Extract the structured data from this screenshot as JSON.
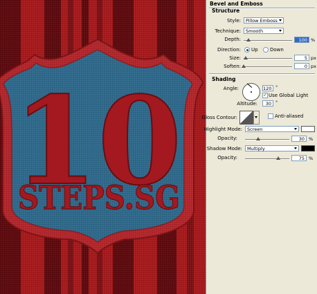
{
  "panel": {
    "title": "Bevel and Emboss",
    "structure": {
      "heading": "Structure",
      "style_label": "Style:",
      "style_value": "Pillow Emboss",
      "technique_label": "Technique:",
      "technique_value": "Smooth",
      "depth_label": "Depth:",
      "depth_value": "100",
      "depth_unit": "%",
      "depth_level": 0.1,
      "direction_label": "Direction:",
      "direction_up": "Up",
      "direction_down": "Down",
      "direction_selected": "Up",
      "size_label": "Size:",
      "size_value": "5",
      "size_unit": "px",
      "size_level": 0.04,
      "soften_label": "Soften:",
      "soften_value": "0",
      "soften_unit": "px",
      "soften_level": 0.0
    },
    "shading": {
      "heading": "Shading",
      "angle_label": "Angle:",
      "angle_value": "120",
      "angle_unit": "°",
      "use_global_light_label": "Use Global Light",
      "use_global_light_checked": true,
      "altitude_label": "Altitude:",
      "altitude_value": "30",
      "altitude_unit": "°",
      "gloss_contour_label": "Gloss Contour:",
      "anti_aliased_label": "Anti-aliased",
      "anti_aliased_checked": false,
      "highlight_mode_label": "Highlight Mode:",
      "highlight_mode_value": "Screen",
      "highlight_color": "#ffffff",
      "highlight_opacity_label": "Opacity:",
      "highlight_opacity_value": "30",
      "highlight_opacity_unit": "%",
      "highlight_opacity_level": 0.3,
      "shadow_mode_label": "Shadow Mode:",
      "shadow_mode_value": "Multiply",
      "shadow_color": "#000000",
      "shadow_opacity_label": "Opacity:",
      "shadow_opacity_value": "75",
      "shadow_opacity_unit": "%",
      "shadow_opacity_level": 0.75
    }
  },
  "artwork": {
    "number_text": "10",
    "brand_text": "STEPS.SG",
    "colors": {
      "background_red": "#a8191c",
      "stripe_dark": "#5e0a0e",
      "shield_border": "#b4262b",
      "shield_fill": "#2f6a8c",
      "text_red": "#a3191f"
    }
  }
}
